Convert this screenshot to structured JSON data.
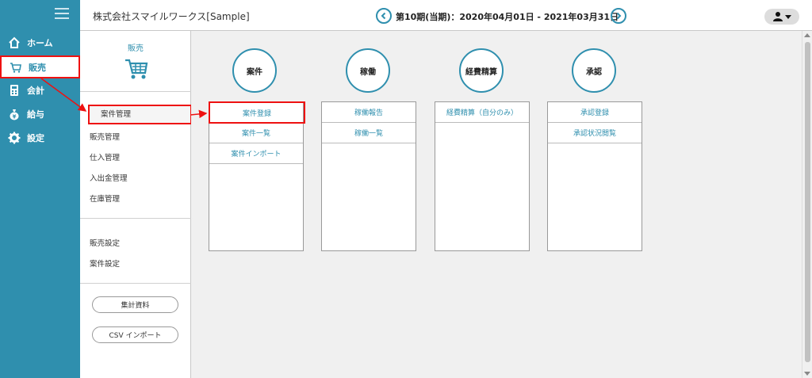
{
  "nav": {
    "items": [
      {
        "label": "ホーム",
        "icon": "home-icon"
      },
      {
        "label": "販売",
        "icon": "cart-icon"
      },
      {
        "label": "会計",
        "icon": "calculator-icon"
      },
      {
        "label": "給与",
        "icon": "money-bag-icon"
      },
      {
        "label": "設定",
        "icon": "gear-icon"
      }
    ]
  },
  "header": {
    "company": "株式会社スマイルワークス[Sample]",
    "period": "第10期(当期)：2020年04月01日 - 2021年03月31日"
  },
  "subnav": {
    "title": "販売",
    "group1": [
      "案件管理",
      "販売管理",
      "仕入管理",
      "入出金管理",
      "在庫管理"
    ],
    "group2": [
      "販売設定",
      "案件設定"
    ],
    "buttons": [
      "集計資料",
      "CSV インポート"
    ]
  },
  "main": {
    "categories": [
      {
        "title": "案件",
        "items": [
          "案件登録",
          "案件一覧",
          "案件インポート"
        ]
      },
      {
        "title": "稼働",
        "items": [
          "稼働報告",
          "稼働一覧"
        ]
      },
      {
        "title": "経費精算",
        "items": [
          "経費精算（自分のみ）"
        ]
      },
      {
        "title": "承認",
        "items": [
          "承認登録",
          "承認状況閲覧"
        ]
      }
    ]
  },
  "colors": {
    "accent": "#2f8fae",
    "highlight": "#e11111",
    "background": "#f0f0f0"
  }
}
